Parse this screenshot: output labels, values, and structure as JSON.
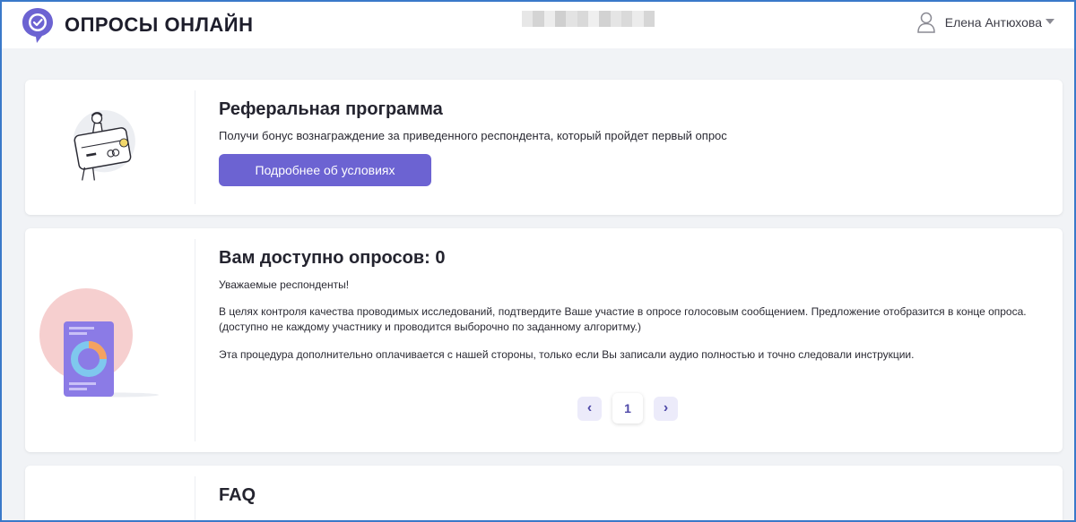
{
  "header": {
    "logo_text": "ОПРОСЫ ОНЛАЙН",
    "user_name": "Елена Антюхова"
  },
  "referral": {
    "title": "Реферальная программа",
    "description": "Получи бонус вознаграждение за приведенного респондента, который пройдет первый опрос",
    "button_label": "Подробнее об условиях"
  },
  "surveys": {
    "title": "Вам доступно опросов: 0",
    "greeting": "Уважаемые респонденты!",
    "paragraph1_line1": "В целях контроля качества проводимых исследований, подтвердите Ваше участие в опросе голосовым сообщением. Предложение отобразится в конце опроса.",
    "paragraph1_line2": "(доступно не каждому участнику и проводится выборочно по заданному алгоритму.)",
    "paragraph2": "Эта процедура дополнительно оплачивается с нашей стороны, только если Вы записали аудио полностью и точно следовали инструкции.",
    "pagination": {
      "prev": "‹",
      "current_page": "1",
      "next": "›"
    }
  },
  "faq": {
    "title": "FAQ"
  },
  "colors": {
    "accent": "#6c63d2",
    "frame_border": "#3a79c9",
    "background": "#f1f3f6"
  }
}
